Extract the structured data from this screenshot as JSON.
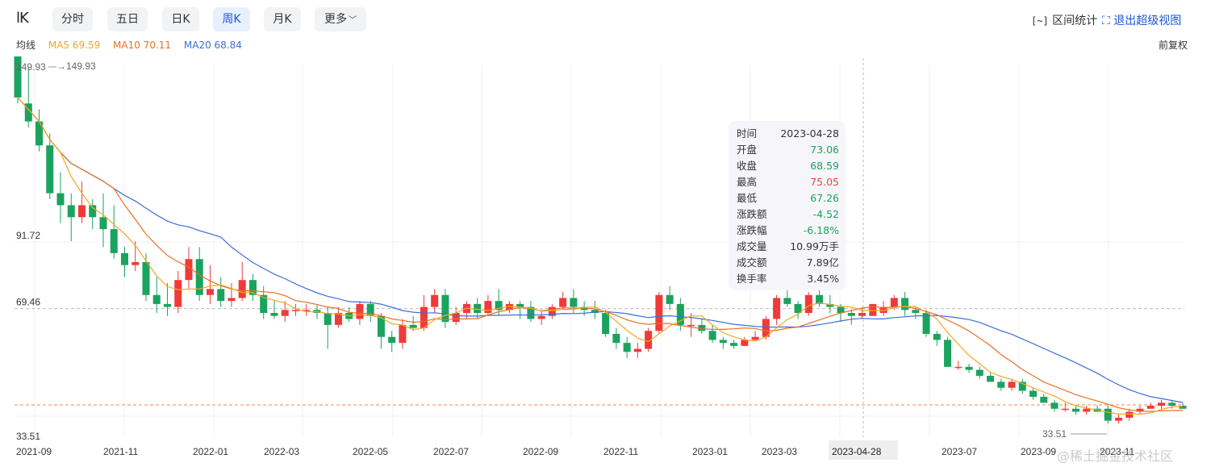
{
  "toolbar": {
    "logo": "lK",
    "tabs": [
      {
        "label": "分时"
      },
      {
        "label": "五日"
      },
      {
        "label": "日K"
      },
      {
        "label": "周K"
      },
      {
        "label": "月K"
      },
      {
        "label": "更多"
      }
    ],
    "active_tab": "周K",
    "range_stats": "区间统计",
    "exit_view": "退出超级视图"
  },
  "ma_legend": {
    "label": "均线",
    "ma5": "MA5 69.59",
    "ma10": "MA10 70.11",
    "ma20": "MA20 68.84"
  },
  "adjust": "前复权",
  "tooltip": {
    "rows": [
      {
        "k": "时间",
        "v": "2023-04-28",
        "color": "#333333"
      },
      {
        "k": "开盘",
        "v": "73.06",
        "color": "#1aa35e"
      },
      {
        "k": "收盘",
        "v": "68.59",
        "color": "#1aa35e"
      },
      {
        "k": "最高",
        "v": "75.05",
        "color": "#e84545"
      },
      {
        "k": "最低",
        "v": "67.26",
        "color": "#1aa35e"
      },
      {
        "k": "涨跌额",
        "v": "-4.52",
        "color": "#1aa35e"
      },
      {
        "k": "涨跌幅",
        "v": "-6.18%",
        "color": "#1aa35e"
      },
      {
        "k": "成交量",
        "v": "10.99万手",
        "color": "#333333"
      },
      {
        "k": "成交额",
        "v": "7.89亿",
        "color": "#333333"
      },
      {
        "k": "换手率",
        "v": "3.45%",
        "color": "#333333"
      }
    ]
  },
  "colors": {
    "up": "#f03a3a",
    "down": "#1aa35e",
    "ma5": "#f5a623",
    "ma10": "#e8702a",
    "ma20": "#3a6fd8",
    "accent": "#1a56db"
  },
  "watermark": "@稀土掘金技术社区",
  "chart_data": {
    "type": "candlestick",
    "period": "weekly",
    "y_labels": [
      "91.72",
      "69.46",
      "33.51"
    ],
    "y_dashed_ref": 69.46,
    "current_price_line": 33.51,
    "max_label": "149.93",
    "min_label": "33.51",
    "max_price": 149.93,
    "min_price": 33.51,
    "x_labels": [
      "2021-09",
      "2021-11",
      "2022-01",
      "2022-03",
      "2022-05",
      "2022-07",
      "2022-09",
      "2022-11",
      "2023-01",
      "2023-03",
      "2023-04-28",
      "2023-07",
      "2023-09",
      "2023-11"
    ],
    "crosshair_date": "2023-04-28",
    "candles": [
      [
        156,
        140,
        160,
        138
      ],
      [
        138,
        132,
        150,
        130
      ],
      [
        132,
        124,
        136,
        122
      ],
      [
        124,
        108,
        128,
        106
      ],
      [
        108,
        104,
        115,
        98
      ],
      [
        104,
        100,
        108,
        92
      ],
      [
        100,
        104,
        112,
        98
      ],
      [
        104,
        100,
        106,
        96
      ],
      [
        100,
        96,
        108,
        90
      ],
      [
        96,
        88,
        104,
        86
      ],
      [
        88,
        84,
        90,
        80
      ],
      [
        84,
        85,
        92,
        82
      ],
      [
        85,
        74,
        88,
        72
      ],
      [
        74,
        71,
        80,
        68
      ],
      [
        71,
        70,
        78,
        67
      ],
      [
        70,
        79,
        82,
        68
      ],
      [
        79,
        86,
        90,
        76
      ],
      [
        86,
        74,
        90,
        72
      ],
      [
        74,
        76,
        84,
        71
      ],
      [
        76,
        72,
        80,
        70
      ],
      [
        72,
        73,
        78,
        70
      ],
      [
        73,
        79,
        85,
        72
      ],
      [
        79,
        74,
        81,
        72
      ],
      [
        74,
        68,
        77,
        66
      ],
      [
        68,
        67,
        72,
        66
      ],
      [
        67,
        69,
        72,
        65
      ],
      [
        69,
        69,
        71,
        67
      ],
      [
        69,
        69,
        71,
        67
      ],
      [
        69,
        68,
        71,
        66
      ],
      [
        68,
        64,
        70,
        56
      ],
      [
        64,
        68,
        70,
        63
      ],
      [
        68,
        66,
        70,
        65
      ],
      [
        66,
        71,
        72,
        64
      ],
      [
        71,
        67,
        72,
        65
      ],
      [
        67,
        60,
        68,
        56
      ],
      [
        60,
        58,
        62,
        55
      ],
      [
        58,
        64,
        66,
        56
      ],
      [
        64,
        63,
        67,
        62
      ],
      [
        63,
        70,
        74,
        62
      ],
      [
        70,
        74,
        76,
        68
      ],
      [
        74,
        65,
        76,
        63
      ],
      [
        65,
        68,
        70,
        64
      ],
      [
        68,
        71,
        72,
        66
      ],
      [
        71,
        68,
        73,
        66
      ],
      [
        68,
        72,
        74,
        67
      ],
      [
        72,
        69,
        76,
        67
      ],
      [
        69,
        71,
        72,
        68
      ],
      [
        71,
        70,
        72,
        66
      ],
      [
        70,
        66,
        72,
        65
      ],
      [
        66,
        67,
        69,
        64
      ],
      [
        67,
        70,
        71,
        66
      ],
      [
        70,
        73,
        75,
        69
      ],
      [
        73,
        70,
        76,
        68
      ],
      [
        70,
        69,
        72,
        67
      ],
      [
        69,
        68,
        72,
        66
      ],
      [
        68,
        61,
        69,
        60
      ],
      [
        61,
        58,
        63,
        56
      ],
      [
        58,
        55,
        60,
        53
      ],
      [
        55,
        56,
        58,
        53
      ],
      [
        56,
        62,
        63,
        55
      ],
      [
        62,
        74,
        75,
        61
      ],
      [
        74,
        71,
        77,
        69
      ],
      [
        71,
        64,
        73,
        62
      ],
      [
        64,
        64,
        68,
        60
      ],
      [
        64,
        62,
        66,
        61
      ],
      [
        62,
        59,
        64,
        58
      ],
      [
        59,
        58,
        60,
        56
      ],
      [
        58,
        57,
        59,
        56
      ],
      [
        57,
        59,
        60,
        57
      ],
      [
        59,
        60,
        62,
        59
      ],
      [
        60,
        66,
        67,
        59
      ],
      [
        66,
        73,
        74,
        64
      ],
      [
        73,
        71,
        77,
        70
      ],
      [
        71,
        68,
        72,
        66
      ],
      [
        68,
        74,
        75,
        67
      ],
      [
        74,
        71,
        76,
        70
      ],
      [
        71,
        70,
        74,
        68
      ],
      [
        70,
        68,
        71,
        65
      ],
      [
        68,
        67,
        69,
        64
      ],
      [
        67,
        68,
        70,
        66
      ],
      [
        67,
        71,
        71,
        69
      ],
      [
        68,
        70,
        72,
        67
      ],
      [
        70,
        73,
        74,
        69
      ],
      [
        73,
        69,
        75,
        67
      ],
      [
        69,
        68,
        70,
        66
      ],
      [
        68,
        61,
        69,
        60
      ],
      [
        61,
        59,
        62,
        57
      ],
      [
        59,
        50,
        60,
        50
      ],
      [
        50,
        50,
        52,
        49
      ],
      [
        50,
        49,
        51,
        48
      ],
      [
        49,
        47,
        50,
        46
      ],
      [
        47,
        45,
        48,
        45
      ],
      [
        45,
        43,
        46,
        42
      ],
      [
        43,
        45,
        46,
        42
      ],
      [
        45,
        42,
        46,
        41
      ],
      [
        42,
        40,
        43,
        39
      ],
      [
        40,
        38,
        41,
        38
      ],
      [
        38,
        36,
        39,
        35
      ],
      [
        36,
        36,
        38,
        35
      ],
      [
        36,
        35,
        37,
        34
      ],
      [
        35,
        36,
        37,
        34
      ],
      [
        36,
        35,
        37,
        35
      ],
      [
        36,
        32,
        37,
        31
      ],
      [
        32,
        33,
        34,
        31
      ],
      [
        33,
        35,
        36,
        32
      ],
      [
        35,
        36,
        37,
        34
      ],
      [
        36,
        37,
        38,
        36
      ],
      [
        37,
        38,
        39,
        36
      ],
      [
        38,
        37,
        39,
        36
      ],
      [
        37,
        36,
        38,
        36
      ]
    ]
  }
}
